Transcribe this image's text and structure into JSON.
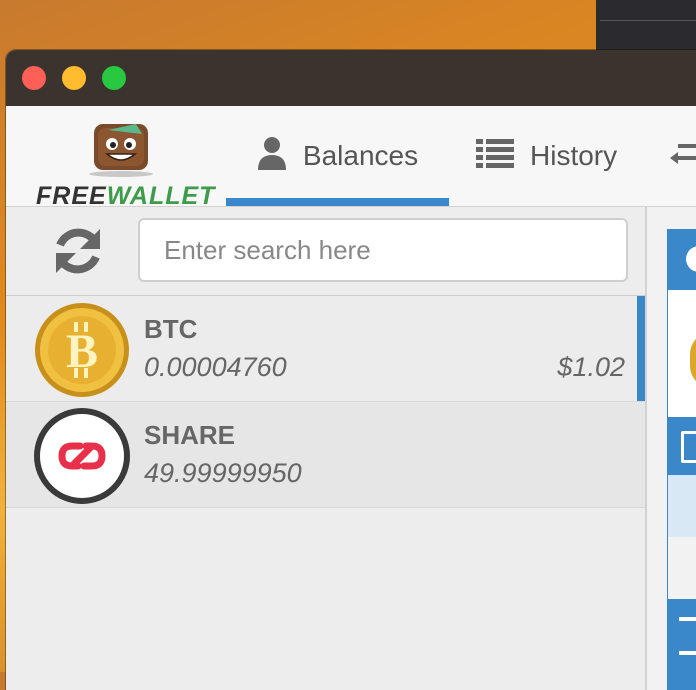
{
  "app": {
    "logo_free": "FREE",
    "logo_wallet": "WALLET"
  },
  "tabs": {
    "balances": "Balances",
    "history": "History",
    "active": "Balances"
  },
  "search": {
    "placeholder": "Enter search here",
    "value": ""
  },
  "balances": [
    {
      "asset": "BTC",
      "amount": "0.00004760",
      "value": "$1.02",
      "icon": "bitcoin-coin-icon",
      "selected": true
    },
    {
      "asset": "SHARE",
      "amount": "49.99999950",
      "value": "",
      "icon": "share-token-icon",
      "selected": false
    }
  ],
  "colors": {
    "accent": "#3a87c9",
    "logo_green": "#3e9b4a",
    "titlebar": "#3a332e"
  }
}
